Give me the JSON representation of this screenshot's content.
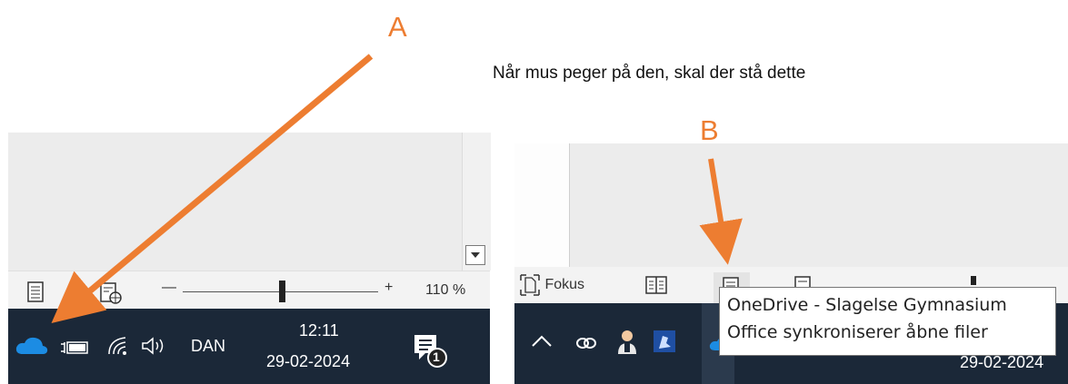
{
  "annotations": {
    "label_a": "A",
    "label_b": "B",
    "caption": "Når mus peger på den, skal der stå dette",
    "arrow_color": "#ED7D31"
  },
  "left": {
    "statusbar": {
      "zoom_minus": "—",
      "zoom_plus": "+",
      "zoom_percent": "110 %"
    },
    "taskbar": {
      "language": "DAN",
      "time": "12:11",
      "date": "29-02-2024",
      "notification_count": "1",
      "icons": [
        "onedrive-cloud-icon",
        "battery-icon",
        "wifi-icon",
        "speaker-icon",
        "notification-icon"
      ]
    }
  },
  "right": {
    "statusbar": {
      "focus_label": "Fokus"
    },
    "taskbar": {
      "date": "29-02-2024",
      "icons": [
        "chevron-up-icon",
        "link-icon",
        "person-icon",
        "app-icon",
        "onedrive-cloud-icon"
      ]
    },
    "tooltip": {
      "line1": "OneDrive - Slagelse Gymnasium",
      "line2": "Office synkroniserer åbne filer"
    }
  }
}
